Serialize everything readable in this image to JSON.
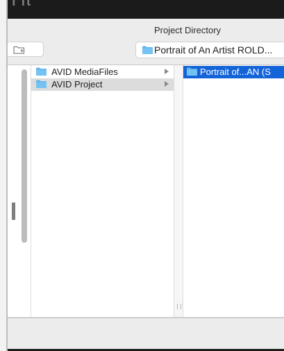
{
  "window": {
    "partial_title": "l  ft"
  },
  "dialog": {
    "title": "Project Directory"
  },
  "path_popup": {
    "label": "Portrait of An Artist ROLD..."
  },
  "column1": {
    "items": [
      {
        "label": "AVID MediaFiles",
        "has_children": true,
        "state": "normal"
      },
      {
        "label": "AVID Project",
        "has_children": true,
        "state": "selected-inactive"
      }
    ]
  },
  "column2": {
    "items": [
      {
        "label": "Portrait of...AN (S",
        "state": "selected-active"
      }
    ]
  },
  "colors": {
    "accent": "#1464d9",
    "folder": "#5fb6ef",
    "selected_gray": "#dcdcdc",
    "dialog_bg": "#ececec"
  },
  "icons": {
    "new_folder": "new-folder-icon",
    "folder": "folder-icon",
    "chevron": "chevron-right-icon"
  }
}
